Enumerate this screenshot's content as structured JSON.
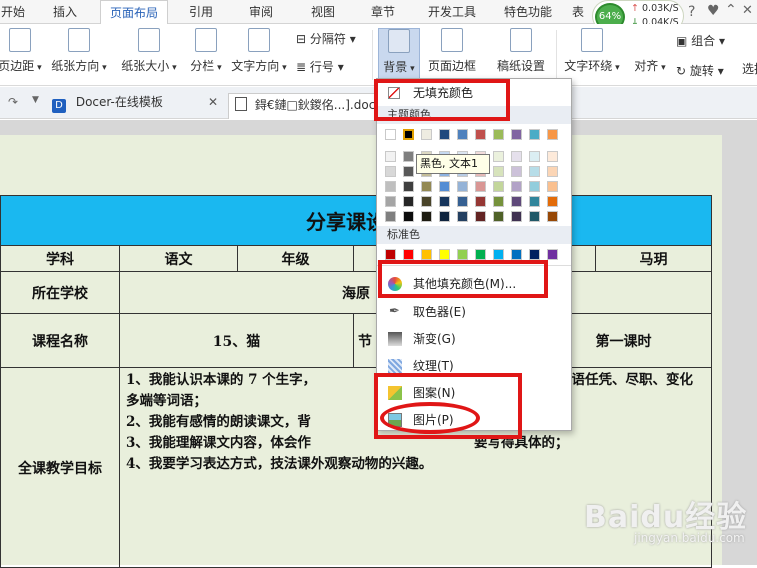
{
  "menu_tabs": [
    "开始",
    "插入",
    "页面布局",
    "引用",
    "审阅",
    "视图",
    "章节",
    "开发工具",
    "特色功能",
    "表"
  ],
  "active_tab": "页面布局",
  "network": {
    "percent": "64%",
    "up": "0.03K/S",
    "down": "0.04K/S"
  },
  "ribbon": {
    "margins": "页边距",
    "orientation": "纸张方向",
    "size": "纸张大小",
    "columns": "分栏",
    "text_direction": "文字方向",
    "break": "分隔符",
    "line_number": "行号",
    "background": "背景",
    "page_border": "页面边框",
    "manuscript": "稿纸设置",
    "wrap": "文字环绕",
    "align": "对齐",
    "group": "组合",
    "rotate": "旋转",
    "select": "选择"
  },
  "doc_tabs": {
    "template": "Docer-在线模板",
    "file": "鍀€鏈□鈥鍐佲...].doc"
  },
  "dropdown": {
    "no_fill": "无填充颜色",
    "theme_header": "主题颜色",
    "standard_header": "标准色",
    "more_colors": "其他填充颜色(M)...",
    "eyedropper": "取色器(E)",
    "gradient": "渐变(G)",
    "texture": "纹理(T)",
    "pattern": "图案(N)",
    "picture": "图片(P)",
    "tooltip": "黑色, 文本1",
    "theme_top": [
      "#ffffff",
      "#000000",
      "#eeece1",
      "#1f497d",
      "#4f81bd",
      "#c0504d",
      "#9bbb59",
      "#8064a2",
      "#4bacc6",
      "#f79646"
    ],
    "theme_shades": [
      [
        "#f2f2f2",
        "#7f7f7f",
        "#ddd9c3",
        "#c6d9f0",
        "#dbe5f1",
        "#f2dcdb",
        "#ebf1dd",
        "#e5e0ec",
        "#dbeef3",
        "#fdeada"
      ],
      [
        "#d8d8d8",
        "#595959",
        "#c4bd97",
        "#8db3e2",
        "#b8cce4",
        "#e5b9b7",
        "#d7e3bc",
        "#ccc1d9",
        "#b7dde8",
        "#fbd5b5"
      ],
      [
        "#bfbfbf",
        "#3f3f3f",
        "#938953",
        "#548dd4",
        "#95b3d7",
        "#d99694",
        "#c3d69b",
        "#b2a2c7",
        "#92cddc",
        "#fac08f"
      ],
      [
        "#a5a5a5",
        "#262626",
        "#494429",
        "#17365d",
        "#366092",
        "#953734",
        "#76923c",
        "#5f497a",
        "#31859b",
        "#e36c09"
      ],
      [
        "#7f7f7f",
        "#0c0c0c",
        "#1d1b10",
        "#0f243e",
        "#244061",
        "#632423",
        "#4f6128",
        "#3f3151",
        "#205867",
        "#974806"
      ]
    ],
    "standard": [
      "#c00000",
      "#ff0000",
      "#ffc000",
      "#ffff00",
      "#92d050",
      "#00b050",
      "#00b0f0",
      "#0070c0",
      "#002060",
      "#7030a0"
    ]
  },
  "table": {
    "title": "分享课设",
    "subject_label": "学科",
    "subject": "语文",
    "grade_label": "年级",
    "author": "马玥",
    "school_label": "所在学校",
    "school": "海原",
    "course_label": "课程名称",
    "course": "15、猫",
    "section_label": "节",
    "section_value": "第一课时",
    "goals_label": "全课教学目标",
    "goals": [
      "1、我能认识本课的 7 个生字，",
      "多端等词语；",
      "2、我能有感情的朗读课文，背",
      "3、我能理解课文内容，体会作",
      "4、我要学习表达方式，技法课外观察动物的兴趣。"
    ],
    "goals_right1": "词语任凭、尽职、变化",
    "goals_right3": "要写得具体的；"
  },
  "watermark": {
    "main": "Baidu经验",
    "sub": "jingyan.baidu.com"
  }
}
